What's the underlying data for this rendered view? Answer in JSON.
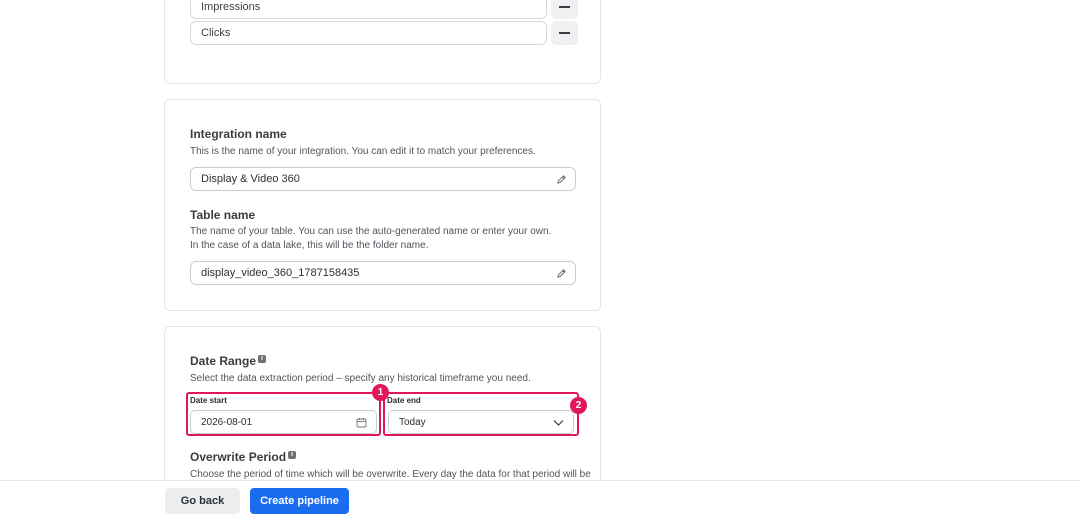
{
  "metrics": {
    "items": [
      {
        "label": "Impressions"
      },
      {
        "label": "Clicks"
      }
    ]
  },
  "integration": {
    "title": "Integration name",
    "description": "This is the name of your integration. You can edit it to match your preferences.",
    "value": "Display & Video 360"
  },
  "table": {
    "title": "Table name",
    "description_line1": "The name of your table. You can use the auto-generated name or enter your own.",
    "description_line2": "In the case of a data lake, this will be the folder name.",
    "value": "display_video_360_1787158435"
  },
  "date_range": {
    "title": "Date Range",
    "description": "Select the data extraction period – specify any historical timeframe you need.",
    "start_label": "Date start",
    "start_value": "2026-08-01",
    "end_label": "Date end",
    "end_value": "Today",
    "badge_1": "1",
    "badge_2": "2"
  },
  "overwrite": {
    "title": "Overwrite Period",
    "description": "Choose the period of time which will be overwrite. Every day the data for that period will be"
  },
  "footer": {
    "back_label": "Go back",
    "create_label": "Create pipeline"
  },
  "colors": {
    "accent": "#1a6cf0",
    "highlight": "#e0175c"
  }
}
